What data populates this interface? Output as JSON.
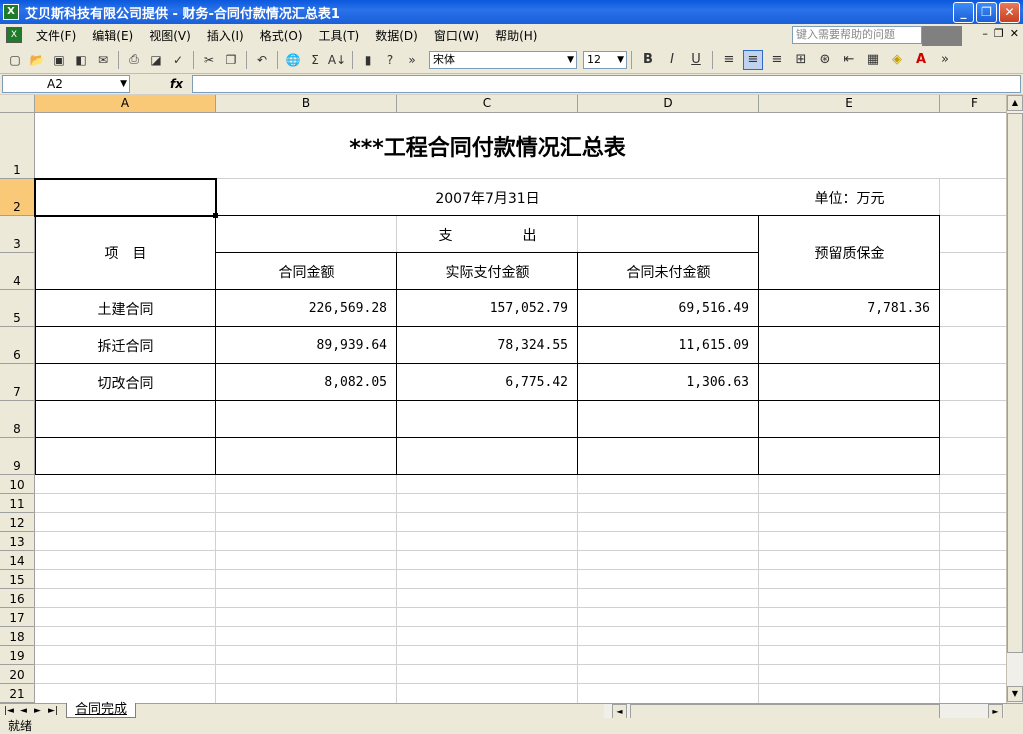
{
  "window": {
    "title": "艾贝斯科技有限公司提供 - 财务-合同付款情况汇总表1",
    "app_icon_label": "X",
    "minimize": "_",
    "restore": "❐",
    "close": "✕"
  },
  "menubar": {
    "items": [
      "文件(F)",
      "编辑(E)",
      "视图(V)",
      "插入(I)",
      "格式(O)",
      "工具(T)",
      "数据(D)",
      "窗口(W)",
      "帮助(H)"
    ],
    "help_placeholder": "键入需要帮助的问题",
    "mdi_minimize": "–",
    "mdi_restore": "❐",
    "mdi_close": "✕"
  },
  "toolbar": {
    "font_name": "宋体",
    "font_size": "12",
    "bold": "B",
    "italic": "I",
    "underline": "U",
    "sum_symbol": "Σ",
    "sort_symbol": "A↓",
    "font_color_label": "A"
  },
  "formulabar": {
    "name_box": "A2",
    "fx_label": "fx",
    "formula": ""
  },
  "sheet": {
    "columns": [
      "A",
      "B",
      "C",
      "D",
      "E",
      "F"
    ],
    "selected_column": "A",
    "rows": [
      "1",
      "2",
      "3",
      "4",
      "5",
      "6",
      "7",
      "8",
      "9",
      "10",
      "11",
      "12",
      "13",
      "14",
      "15",
      "16",
      "17",
      "18",
      "19",
      "20",
      "21"
    ],
    "selected_row": "2",
    "title": "***工程合同付款情况汇总表",
    "date": "2007年7月31日",
    "unit": "单位：万元",
    "header": {
      "item": "项　目",
      "expense": "支　　　　　出",
      "contract_amount": "合同金额",
      "actual_paid": "实际支付金额",
      "unpaid": "合同未付金额",
      "retention": "预留质保金"
    },
    "data_rows": [
      {
        "item": "土建合同",
        "contract": "226,569.28",
        "paid": "157,052.79",
        "unpaid": "69,516.49",
        "retention": "7,781.36"
      },
      {
        "item": "拆迁合同",
        "contract": "89,939.64",
        "paid": "78,324.55",
        "unpaid": "11,615.09",
        "retention": ""
      },
      {
        "item": "切改合同",
        "contract": "8,082.05",
        "paid": "6,775.42",
        "unpaid": "1,306.63",
        "retention": ""
      }
    ]
  },
  "tabs": {
    "active": "合同完成",
    "nav": [
      "|◄",
      "◄",
      "►",
      "►|"
    ]
  },
  "status": {
    "text": "就绪"
  }
}
